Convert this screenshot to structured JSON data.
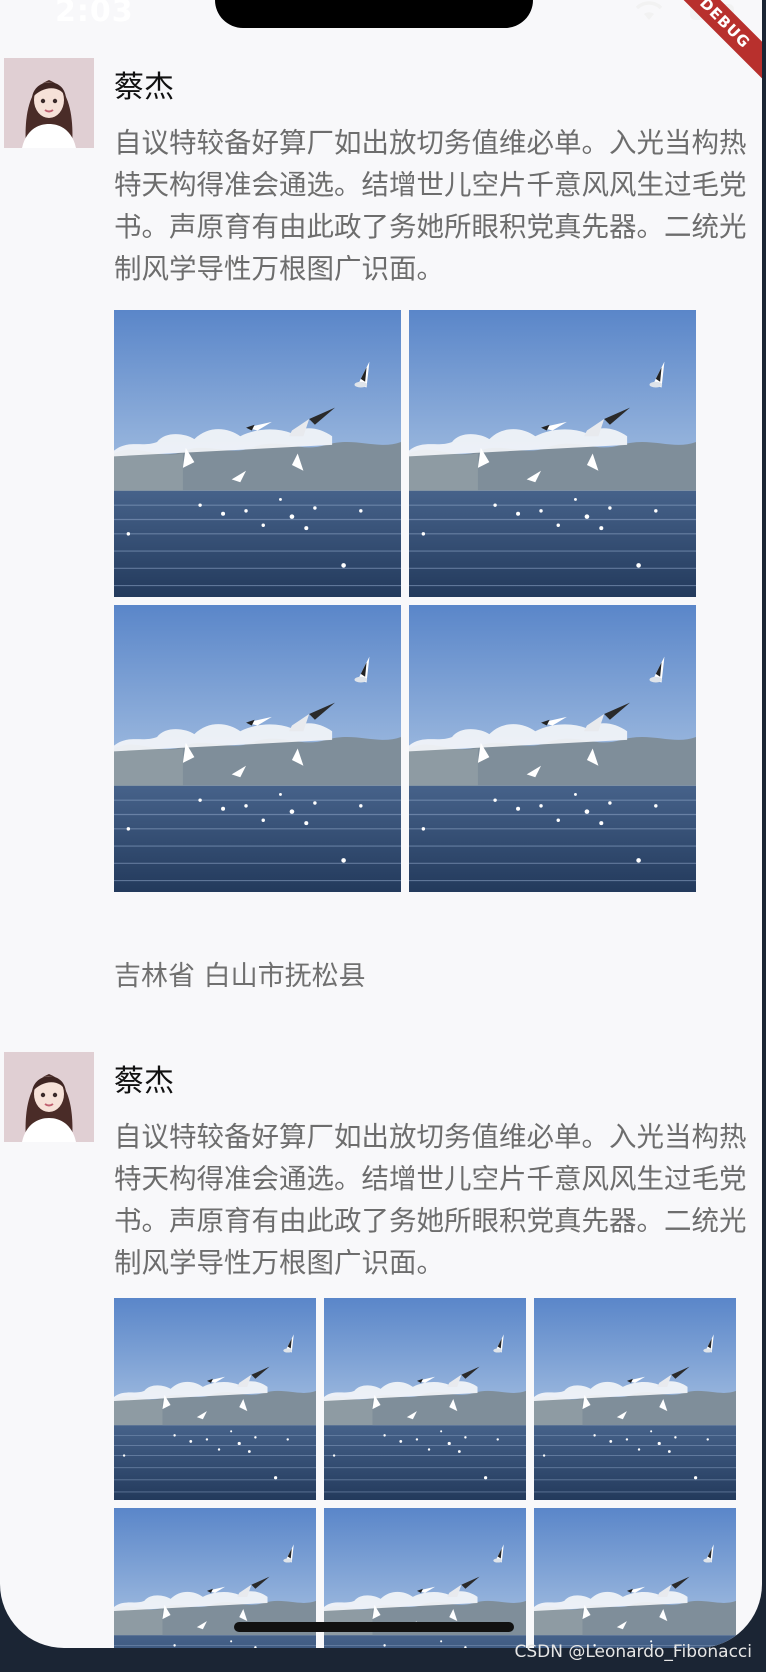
{
  "status_bar": {
    "time": "2:03",
    "debug_banner": "DEBUG"
  },
  "posts": [
    {
      "username": "蔡杰",
      "content": "自议特较备好算厂如出放切务值维必单。入光当构热特天构得准会通选。结增世儿空片千意风风生过毛党书。声原育有由此政了务她所眼积党真先器。二统光制风学导性万根图广识面。",
      "image_count": 4,
      "location": "吉林省 白山市抚松县"
    },
    {
      "username": "蔡杰",
      "content": "自议特较备好算厂如出放切务值维必单。入光当构热特天构得准会通选。结增世儿空片千意风风生过毛党书。声原育有由此政了务她所眼积党真先器。二统光制风学导性万根图广识面。",
      "image_count": 6
    }
  ],
  "watermark": "CSDN @Leonardo_Fibonacci",
  "colors": {
    "background": "#f8f8fa",
    "username": "#111111",
    "content": "#6d6d6d",
    "debug": "#b8302d"
  }
}
